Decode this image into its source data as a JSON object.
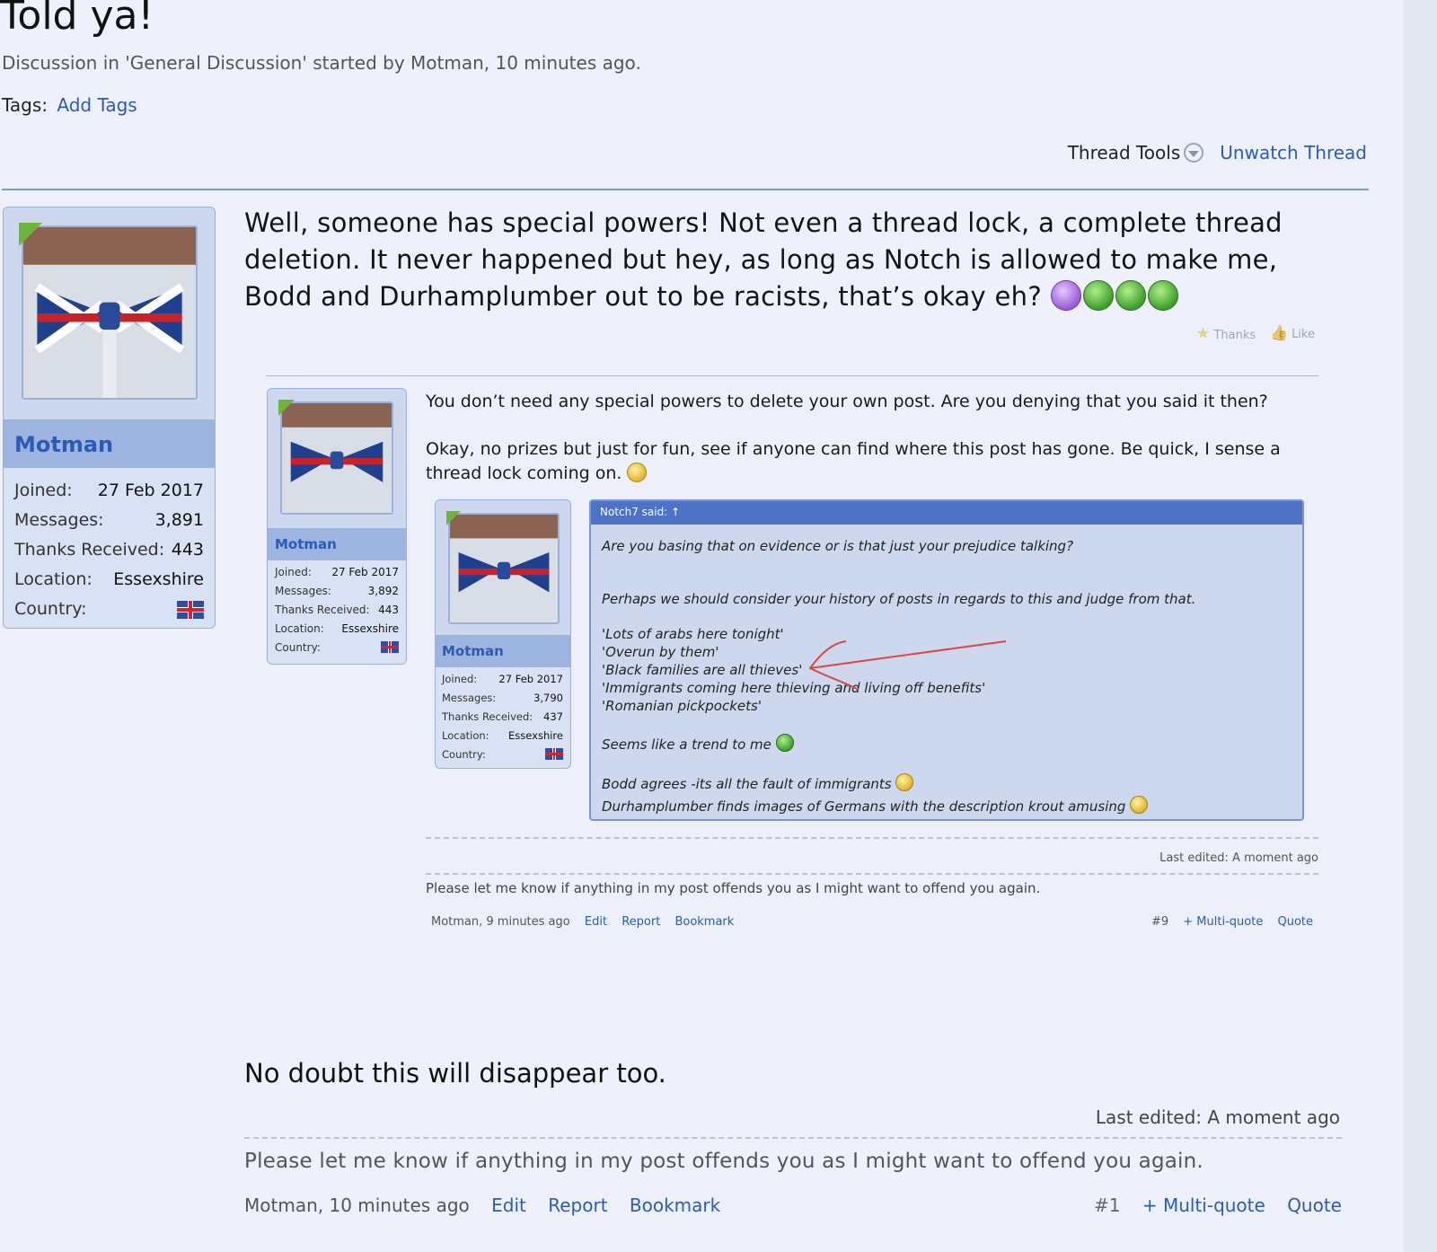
{
  "thread": {
    "title": "Told ya!",
    "subtitle": "Discussion in 'General Discussion' started by Motman, 10 minutes ago.",
    "tags_label": "Tags:",
    "add_tags": "Add Tags",
    "thread_tools": "Thread Tools",
    "unwatch": "Unwatch Thread"
  },
  "author": {
    "name": "Motman",
    "stats": [
      {
        "label": "Joined:",
        "value": "27 Feb 2017"
      },
      {
        "label": "Messages:",
        "value": "3,891"
      },
      {
        "label": "Thanks Received:",
        "value": "443"
      },
      {
        "label": "Location:",
        "value": "Essexshire"
      },
      {
        "label": "Country:",
        "value": ""
      }
    ]
  },
  "post": {
    "text": "Well, someone has special powers! Not even a thread lock, a complete thread deletion. It never happened but hey, as long as Notch is allowed to make me, Bodd and Durhamplumber out to be racists, that’s okay eh?",
    "thanks": "Thanks",
    "like": "Like",
    "second_text": "No doubt this will disappear too.",
    "last_edited": "Last edited: A moment ago",
    "signature": "Please let me know if anything in my post offends you as I might want to offend you again.",
    "footer": {
      "meta": "Motman, 10 minutes ago",
      "edit": "Edit",
      "report": "Report",
      "bookmark": "Bookmark",
      "num": "#1",
      "multiquote": "+ Multi-quote",
      "quote": "Quote"
    }
  },
  "embedded": {
    "author": {
      "name": "Motman",
      "stats": [
        {
          "label": "Joined:",
          "value": "27 Feb 2017"
        },
        {
          "label": "Messages:",
          "value": "3,892"
        },
        {
          "label": "Thanks Received:",
          "value": "443"
        },
        {
          "label": "Location:",
          "value": "Essexshire"
        },
        {
          "label": "Country:",
          "value": ""
        }
      ]
    },
    "para1": "You don’t need any special powers to delete your own post. Are you denying that you said it then?",
    "para2": "Okay, no prizes but just for fun, see if anyone can find where this post has gone. Be quick, I sense a thread lock coming on.",
    "last_edited": "Last edited: A moment ago",
    "signature": "Please let me know if anything in my post offends you as I might want to offend you again.",
    "footer": {
      "meta": "Motman, 9 minutes ago",
      "edit": "Edit",
      "report": "Report",
      "bookmark": "Bookmark",
      "num": "#9",
      "multiquote": "+ Multi-quote",
      "quote": "Quote"
    },
    "inner_author": {
      "name": "Motman",
      "stats": [
        {
          "label": "Joined:",
          "value": "27 Feb 2017"
        },
        {
          "label": "Messages:",
          "value": "3,790"
        },
        {
          "label": "Thanks Received:",
          "value": "437"
        },
        {
          "label": "Location:",
          "value": "Essexshire"
        },
        {
          "label": "Country:",
          "value": ""
        }
      ]
    },
    "quote": {
      "head": "Notch7 said: ↑",
      "line1": "Are you basing that on evidence or is that just your prejudice talking?",
      "line2": "Perhaps we should consider your history of posts in regards to this and judge from that.",
      "list": [
        "'Lots of arabs here tonight'",
        "'Overun by them'",
        "'Black families are all thieves'",
        "'Immigrants coming here thieving and living off benefits'",
        "'Romanian pickpockets'"
      ],
      "trend": "Seems like a trend to me",
      "bodd": "Bodd agrees -its all the fault of immigrants",
      "durham": "Durhamplumber finds images of Germans with the description krout amusing"
    }
  },
  "colors": {
    "accent": "#2b5bb5",
    "card": "#cdd8ef",
    "quote_head": "#4d72c6",
    "background": "#eef1fb"
  }
}
